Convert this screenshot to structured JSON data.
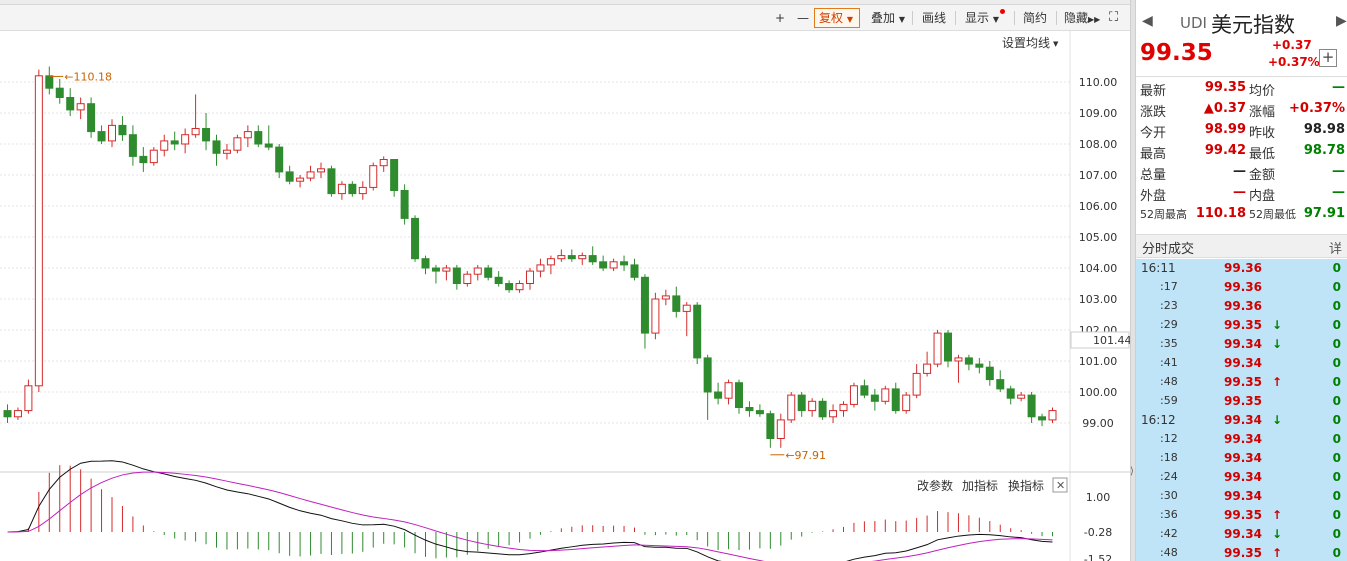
{
  "toolbar": {
    "plus": "+",
    "minus": "—",
    "fuquan": "复权",
    "diejia": "叠加",
    "huaxian": "画线",
    "xianshi": "显示",
    "jianyue": "简约",
    "yincang": "隐藏",
    "setting_ma": "设置均线"
  },
  "chart_data": {
    "type": "candlestick",
    "y_ticks": [
      "110.00",
      "109.00",
      "108.00",
      "107.00",
      "106.00",
      "105.00",
      "104.00",
      "103.00",
      "102.00",
      "101.00",
      "100.00",
      "99.00"
    ],
    "ylim": [
      98.5,
      110.5
    ],
    "crosshair_label": "101.44",
    "high_marker": "110.18",
    "low_marker": "97.91",
    "candles": [
      [
        99.4,
        99.6,
        99.0,
        99.2
      ],
      [
        99.2,
        99.5,
        99.1,
        99.4
      ],
      [
        99.4,
        100.4,
        99.3,
        100.2
      ],
      [
        100.2,
        110.4,
        100.0,
        110.2
      ],
      [
        110.2,
        110.5,
        109.6,
        109.8
      ],
      [
        109.8,
        110.1,
        109.3,
        109.5
      ],
      [
        109.5,
        109.8,
        108.9,
        109.1
      ],
      [
        109.1,
        109.5,
        108.8,
        109.3
      ],
      [
        109.3,
        109.5,
        108.2,
        108.4
      ],
      [
        108.4,
        108.6,
        108.0,
        108.1
      ],
      [
        108.1,
        108.8,
        107.9,
        108.6
      ],
      [
        108.6,
        108.9,
        108.1,
        108.3
      ],
      [
        108.3,
        108.6,
        107.3,
        107.6
      ],
      [
        107.6,
        107.9,
        107.1,
        107.4
      ],
      [
        107.4,
        107.9,
        107.3,
        107.8
      ],
      [
        107.8,
        108.3,
        107.6,
        108.1
      ],
      [
        108.1,
        108.4,
        107.8,
        108.0
      ],
      [
        108.0,
        108.5,
        107.7,
        108.3
      ],
      [
        108.3,
        109.6,
        108.2,
        108.5
      ],
      [
        108.5,
        109.0,
        107.8,
        108.1
      ],
      [
        108.1,
        108.3,
        107.3,
        107.7
      ],
      [
        107.7,
        108.0,
        107.5,
        107.8
      ],
      [
        107.8,
        108.3,
        107.7,
        108.2
      ],
      [
        108.2,
        108.6,
        107.9,
        108.4
      ],
      [
        108.4,
        108.6,
        107.9,
        108.0
      ],
      [
        108.0,
        108.6,
        107.8,
        107.9
      ],
      [
        107.9,
        108.0,
        106.9,
        107.1
      ],
      [
        107.1,
        107.3,
        106.7,
        106.8
      ],
      [
        106.8,
        107.0,
        106.6,
        106.9
      ],
      [
        106.9,
        107.3,
        106.8,
        107.1
      ],
      [
        107.1,
        107.4,
        106.9,
        107.2
      ],
      [
        107.2,
        107.3,
        106.3,
        106.4
      ],
      [
        106.4,
        106.8,
        106.2,
        106.7
      ],
      [
        106.7,
        106.8,
        106.3,
        106.4
      ],
      [
        106.4,
        106.8,
        106.2,
        106.6
      ],
      [
        106.6,
        107.4,
        106.5,
        107.3
      ],
      [
        107.3,
        107.6,
        107.1,
        107.5
      ],
      [
        107.5,
        107.5,
        106.3,
        106.5
      ],
      [
        106.5,
        106.7,
        105.4,
        105.6
      ],
      [
        105.6,
        105.7,
        104.2,
        104.3
      ],
      [
        104.3,
        104.4,
        103.8,
        104.0
      ],
      [
        104.0,
        104.1,
        103.5,
        103.9
      ],
      [
        103.9,
        104.1,
        103.6,
        104.0
      ],
      [
        104.0,
        104.1,
        103.3,
        103.5
      ],
      [
        103.5,
        103.9,
        103.4,
        103.8
      ],
      [
        103.8,
        104.1,
        103.6,
        104.0
      ],
      [
        104.0,
        104.1,
        103.6,
        103.7
      ],
      [
        103.7,
        103.9,
        103.4,
        103.5
      ],
      [
        103.5,
        103.6,
        103.2,
        103.3
      ],
      [
        103.3,
        103.6,
        103.2,
        103.5
      ],
      [
        103.5,
        104.0,
        103.3,
        103.9
      ],
      [
        103.9,
        104.3,
        103.7,
        104.1
      ],
      [
        104.1,
        104.4,
        103.8,
        104.3
      ],
      [
        104.3,
        104.6,
        104.2,
        104.4
      ],
      [
        104.4,
        104.6,
        104.2,
        104.3
      ],
      [
        104.3,
        104.5,
        104.1,
        104.4
      ],
      [
        104.4,
        104.7,
        104.1,
        104.2
      ],
      [
        104.2,
        104.4,
        103.9,
        104.0
      ],
      [
        104.0,
        104.3,
        103.9,
        104.2
      ],
      [
        104.2,
        104.4,
        103.9,
        104.1
      ],
      [
        104.1,
        104.3,
        103.6,
        103.7
      ],
      [
        103.7,
        103.8,
        101.4,
        101.9
      ],
      [
        101.9,
        103.2,
        101.7,
        103.0
      ],
      [
        103.0,
        103.3,
        102.8,
        103.1
      ],
      [
        103.1,
        103.4,
        102.4,
        102.6
      ],
      [
        102.6,
        102.9,
        101.8,
        102.8
      ],
      [
        102.8,
        102.9,
        100.9,
        101.1
      ],
      [
        101.1,
        101.2,
        99.1,
        100.0
      ],
      [
        100.0,
        100.3,
        99.6,
        99.8
      ],
      [
        99.8,
        100.4,
        99.6,
        100.3
      ],
      [
        100.3,
        100.4,
        99.3,
        99.5
      ],
      [
        99.5,
        99.7,
        99.2,
        99.4
      ],
      [
        99.4,
        99.6,
        99.2,
        99.3
      ],
      [
        99.3,
        99.4,
        98.2,
        98.5
      ],
      [
        98.5,
        99.3,
        98.2,
        99.1
      ],
      [
        99.1,
        100.0,
        99.0,
        99.9
      ],
      [
        99.9,
        100.0,
        99.2,
        99.4
      ],
      [
        99.4,
        99.8,
        99.2,
        99.7
      ],
      [
        99.7,
        99.8,
        99.1,
        99.2
      ],
      [
        99.2,
        99.6,
        99.0,
        99.4
      ],
      [
        99.4,
        99.7,
        99.2,
        99.6
      ],
      [
        99.6,
        100.3,
        99.5,
        100.2
      ],
      [
        100.2,
        100.4,
        99.8,
        99.9
      ],
      [
        99.9,
        100.1,
        99.4,
        99.7
      ],
      [
        99.7,
        100.2,
        99.6,
        100.1
      ],
      [
        100.1,
        100.3,
        99.3,
        99.4
      ],
      [
        99.4,
        100.0,
        99.3,
        99.9
      ],
      [
        99.9,
        100.9,
        99.8,
        100.6
      ],
      [
        100.6,
        101.3,
        100.5,
        100.9
      ],
      [
        100.9,
        102.0,
        100.8,
        101.9
      ],
      [
        101.9,
        102.0,
        100.8,
        101.0
      ],
      [
        101.0,
        101.2,
        100.3,
        101.1
      ],
      [
        101.1,
        101.2,
        100.7,
        100.9
      ],
      [
        100.9,
        101.1,
        100.6,
        100.8
      ],
      [
        100.8,
        101.0,
        100.2,
        100.4
      ],
      [
        100.4,
        100.7,
        100.0,
        100.1
      ],
      [
        100.1,
        100.2,
        99.6,
        99.8
      ],
      [
        99.8,
        100.0,
        99.7,
        99.9
      ],
      [
        99.9,
        100.0,
        99.0,
        99.2
      ],
      [
        99.2,
        99.3,
        98.9,
        99.1
      ],
      [
        99.1,
        99.5,
        99.0,
        99.4
      ]
    ],
    "macd": {
      "label_top": "1.00",
      "label_mid": "-0.28",
      "label_bot": "-1.52",
      "buttons": [
        "改参数",
        "加指标",
        "换指标"
      ]
    }
  },
  "panel": {
    "code": "UDI",
    "name": "美元指数",
    "price": "99.35",
    "change": "+0.37",
    "change_pct": "+0.37%",
    "stats": [
      {
        "l1": "最新",
        "v1": "99.35",
        "c1": "red",
        "l2": "均价",
        "v2": "—",
        "c2": "green"
      },
      {
        "l1": "涨跌",
        "v1": "▲0.37",
        "c1": "red",
        "l2": "涨幅",
        "v2": "+0.37%",
        "c2": "red"
      },
      {
        "l1": "今开",
        "v1": "98.99",
        "c1": "red",
        "l2": "昨收",
        "v2": "98.98",
        "c2": "dark"
      },
      {
        "l1": "最高",
        "v1": "99.42",
        "c1": "red",
        "l2": "最低",
        "v2": "98.78",
        "c2": "green"
      },
      {
        "l1": "总量",
        "v1": "—",
        "c1": "dark",
        "l2": "金额",
        "v2": "—",
        "c2": "green"
      },
      {
        "l1": "外盘",
        "v1": "—",
        "c1": "red",
        "l2": "内盘",
        "v2": "—",
        "c2": "green"
      },
      {
        "l1": "52周最高",
        "v1": "110.18",
        "c1": "red",
        "l2": "52周最低",
        "v2": "97.91",
        "c2": "green"
      }
    ],
    "ticks_title": "分时成交",
    "ticks_detail": "详",
    "ticks": [
      {
        "t": "16:11",
        "p": "99.36",
        "a": "",
        "v": "0",
        "bold": true
      },
      {
        "t": ":17",
        "p": "99.36",
        "a": "",
        "v": "0"
      },
      {
        "t": ":23",
        "p": "99.36",
        "a": "",
        "v": "0"
      },
      {
        "t": ":29",
        "p": "99.35",
        "a": "down",
        "v": "0"
      },
      {
        "t": ":35",
        "p": "99.34",
        "a": "down",
        "v": "0"
      },
      {
        "t": ":41",
        "p": "99.34",
        "a": "",
        "v": "0"
      },
      {
        "t": ":48",
        "p": "99.35",
        "a": "up",
        "v": "0"
      },
      {
        "t": ":59",
        "p": "99.35",
        "a": "",
        "v": "0"
      },
      {
        "t": "16:12",
        "p": "99.34",
        "a": "down",
        "v": "0",
        "bold": true
      },
      {
        "t": ":12",
        "p": "99.34",
        "a": "",
        "v": "0"
      },
      {
        "t": ":18",
        "p": "99.34",
        "a": "",
        "v": "0"
      },
      {
        "t": ":24",
        "p": "99.34",
        "a": "",
        "v": "0"
      },
      {
        "t": ":30",
        "p": "99.34",
        "a": "",
        "v": "0"
      },
      {
        "t": ":36",
        "p": "99.35",
        "a": "up",
        "v": "0"
      },
      {
        "t": ":42",
        "p": "99.34",
        "a": "down",
        "v": "0"
      },
      {
        "t": ":48",
        "p": "99.35",
        "a": "up",
        "v": "0"
      }
    ]
  }
}
